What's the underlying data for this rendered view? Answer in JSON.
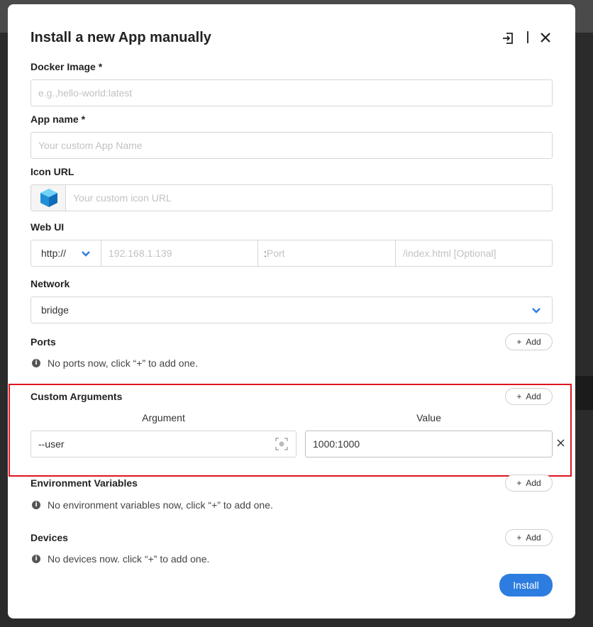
{
  "dialog": {
    "title": "Install a new App manually"
  },
  "docker_image": {
    "label": "Docker Image *",
    "placeholder": "e.g.,hello-world:latest",
    "value": ""
  },
  "app_name": {
    "label": "App name *",
    "placeholder": "Your custom App Name",
    "value": ""
  },
  "icon_url": {
    "label": "Icon URL",
    "placeholder": "Your custom icon URL",
    "value": ""
  },
  "web_ui": {
    "label": "Web UI",
    "protocol": "http://",
    "host_placeholder": "192.168.1.139",
    "port_prefix": ":",
    "port_placeholder": "Port",
    "path_placeholder": "/index.html [Optional]"
  },
  "network": {
    "label": "Network",
    "value": "bridge"
  },
  "ports": {
    "label": "Ports",
    "add_label": "Add",
    "empty_text": "No ports now, click “+” to add one."
  },
  "custom_arguments": {
    "label": "Custom Arguments",
    "add_label": "Add",
    "argument_header": "Argument",
    "value_header": "Value",
    "rows": [
      {
        "argument": "--user",
        "value": "1000:1000"
      }
    ]
  },
  "env_vars": {
    "label": "Environment Variables",
    "add_label": "Add",
    "empty_text": "No environment variables now, click “+” to add one."
  },
  "devices": {
    "label": "Devices",
    "add_label": "Add",
    "empty_text": "No devices now. click “+” to add one."
  },
  "footer": {
    "install_label": "Install"
  },
  "colors": {
    "accent": "#2d7de0",
    "highlight": "#e0141e"
  }
}
